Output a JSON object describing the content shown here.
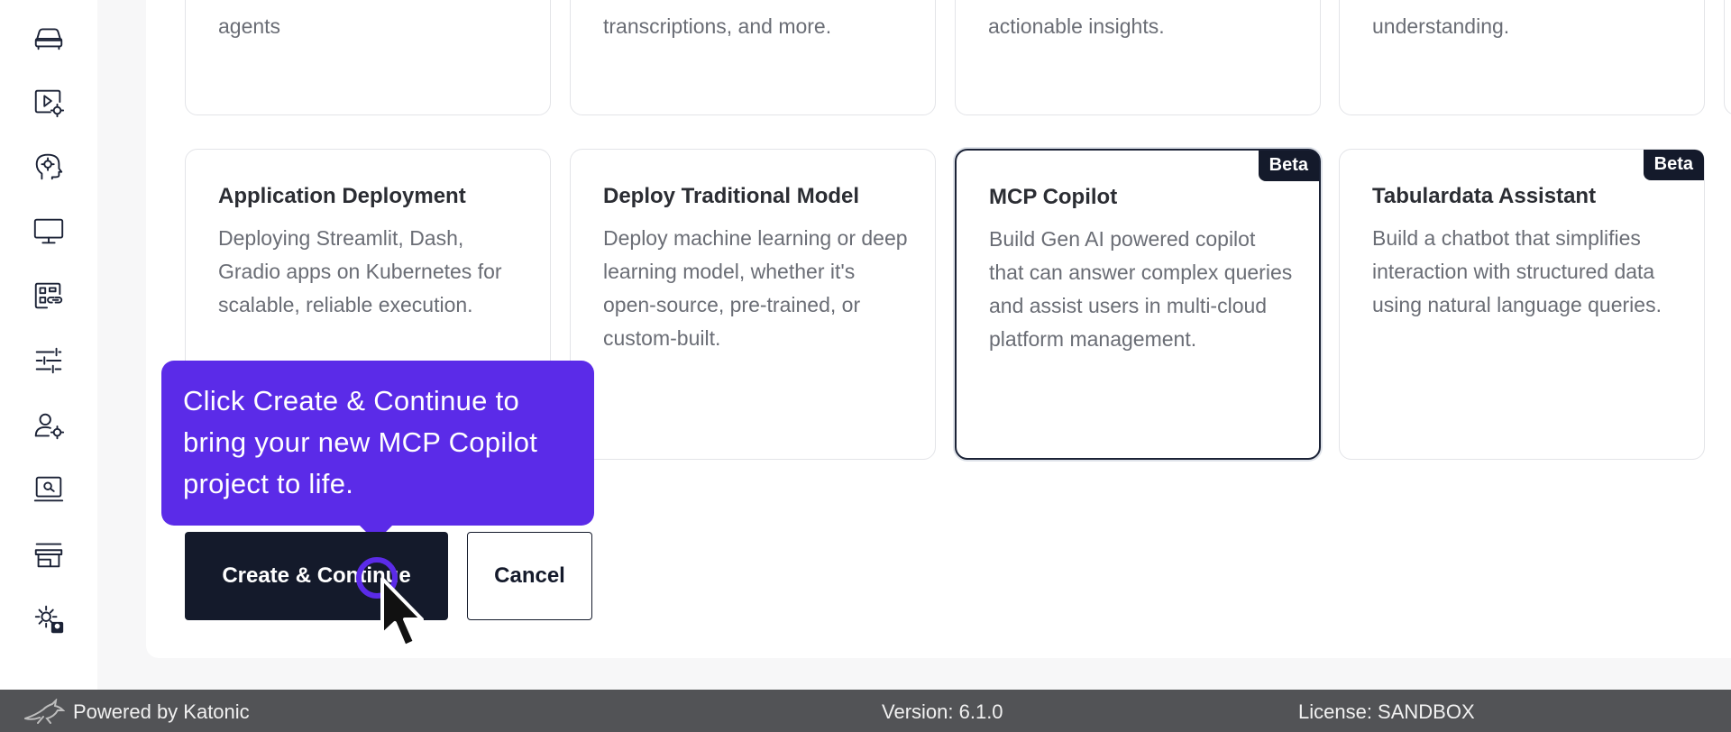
{
  "sidebar": {
    "icons": [
      "car-icon",
      "video-settings-icon",
      "brain-gear-icon",
      "monitor-icon",
      "dashboard-link-icon",
      "sliders-icon",
      "user-settings-icon",
      "screen-search-icon",
      "store-icon",
      "gear-user-icon"
    ]
  },
  "top_cards": [
    {
      "desc_tail": "agents"
    },
    {
      "desc_tail": "transcriptions, and more."
    },
    {
      "desc_tail": "actionable insights."
    },
    {
      "desc_tail": "understanding."
    }
  ],
  "cards": [
    {
      "title": "Application Deployment",
      "desc": "Deploying Streamlit, Dash, Gradio apps on Kubernetes for scalable, reliable execution.",
      "badge": ""
    },
    {
      "title": "Deploy Traditional Model",
      "desc": "Deploy machine learning or deep learning model, whether it's open-source, pre-trained, or custom-built.",
      "badge": ""
    },
    {
      "title": "MCP Copilot",
      "desc": "Build Gen AI powered copilot that can answer complex queries and assist users in multi-cloud platform management.",
      "badge": "Beta"
    },
    {
      "title": "Tabulardata Assistant",
      "desc": "Build a chatbot that simplifies interaction with structured data using natural language queries.",
      "badge": "Beta"
    }
  ],
  "tooltip": {
    "text": "Click Create & Continue to bring your new MCP Copilot project to life."
  },
  "actions": {
    "create_label": "Create & Continue",
    "cancel_label": "Cancel"
  },
  "footer": {
    "powered_by": "Powered by Katonic",
    "version": "Version: 6.1.0",
    "license": "License: SANDBOX"
  }
}
